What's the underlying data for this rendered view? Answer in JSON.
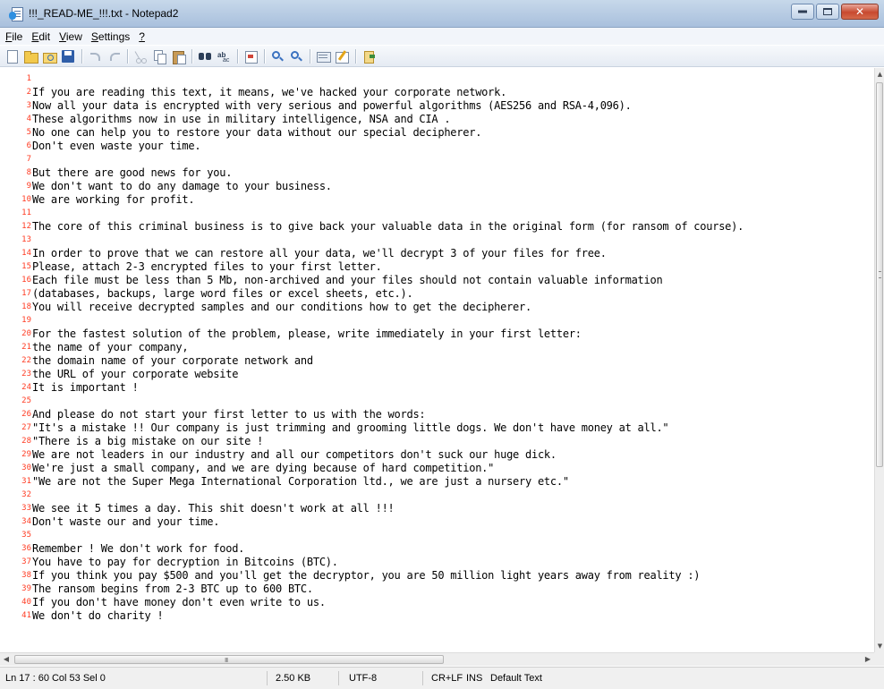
{
  "window": {
    "title": "!!!_READ-ME_!!!.txt - Notepad2",
    "app_icon": "notepad2-icon"
  },
  "menu": [
    {
      "key": "F",
      "rest": "ile"
    },
    {
      "key": "E",
      "rest": "dit"
    },
    {
      "key": "V",
      "rest": "iew"
    },
    {
      "key": "S",
      "rest": "ettings"
    },
    {
      "key": "?",
      "rest": ""
    }
  ],
  "toolbar": [
    "new-file-icon",
    "open-file-icon",
    "browse-icon",
    "save-icon",
    "|",
    "undo-icon",
    "redo-icon",
    "|",
    "cut-icon",
    "copy-icon",
    "paste-icon",
    "|",
    "find-icon",
    "replace-icon",
    "|",
    "word-wrap-icon",
    "|",
    "zoom-in-icon",
    "zoom-out-icon",
    "|",
    "scheme-icon",
    "customize-schemes-icon",
    "|",
    "exit-icon"
  ],
  "editor": {
    "lines": [
      "",
      "If you are reading this text, it means, we've hacked your corporate network.",
      "Now all your data is encrypted with very serious and powerful algorithms (AES256 and RSA-4,096).",
      "These algorithms now in use in military intelligence, NSA and CIA .",
      "No one can help you to restore your data without our special decipherer.",
      "Don't even waste your time.",
      "",
      "But there are good news for you.",
      "We don't want to do any damage to your business.",
      "We are working for profit.",
      "",
      "The core of this criminal business is to give back your valuable data in the original form (for ransom of course).",
      "",
      "In order to prove that we can restore all your data, we'll decrypt 3 of your files for free.",
      "Please, attach 2-3 encrypted files to your first letter.",
      "Each file must be less than 5 Mb, non-archived and your files should not contain valuable information",
      "(databases, backups, large word files or excel sheets, etc.).",
      "You will receive decrypted samples and our conditions how to get the decipherer.",
      "",
      "For the fastest solution of the problem, please, write immediately in your first letter:",
      "the name of your company,",
      "the domain name of your corporate network and",
      "the URL of your corporate website",
      "It is important !",
      "",
      "And please do not start your first letter to us with the words:",
      "\"It's a mistake !! Our company is just trimming and grooming little dogs. We don't have money at all.\"",
      "\"There is a big mistake on our site !",
      "We are not leaders in our industry and all our competitors don't suck our huge dick.",
      "We're just a small company, and we are dying because of hard competition.\"",
      "\"We are not the Super Mega International Corporation ltd., we are just a nursery etc.\"",
      "",
      "We see it 5 times a day. This shit doesn't work at all !!!",
      "Don't waste our and your time.",
      "",
      "Remember ! We don't work for food.",
      "You have to pay for decryption in Bitcoins (BTC).",
      "If you think you pay $500 and you'll get the decryptor, you are 50 million light years away from reality :)",
      "The ransom begins from 2-3 BTC up to 600 BTC.",
      "If you don't have money don't even write to us.",
      "We don't do charity !"
    ],
    "line_number_color": "#ff3b22"
  },
  "scrollbars": {
    "vertical_up": "▲",
    "vertical_down": "▼",
    "horizontal_left": "◀",
    "horizontal_right": "▶",
    "horizontal_grip": "III"
  },
  "status": {
    "position": "Ln 17 : 60   Col 53   Sel 0",
    "size": "2.50 KB",
    "encoding": "UTF-8",
    "line_endings": "CR+LF",
    "mode": "INS",
    "scheme": "Default Text"
  }
}
